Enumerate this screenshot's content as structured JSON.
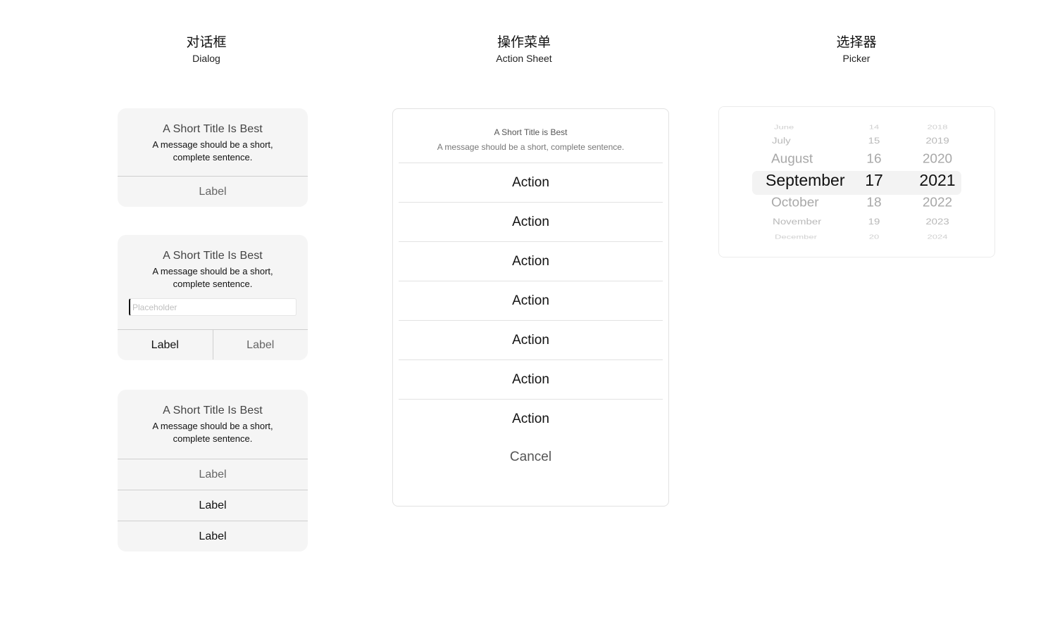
{
  "sections": {
    "dialog": {
      "zh": "对话框",
      "en": "Dialog"
    },
    "action_sheet": {
      "zh": "操作菜单",
      "en": "Action Sheet"
    },
    "picker": {
      "zh": "选择器",
      "en": "Picker"
    }
  },
  "dialogs": [
    {
      "title": "A Short Title Is Best",
      "message_line1": "A message should be a short,",
      "message_line2": "complete sentence.",
      "button": "Label"
    },
    {
      "title": "A Short Title Is Best",
      "message_line1": "A message should be a short,",
      "message_line2": "complete sentence.",
      "input_placeholder": "Placeholder",
      "input_value": "",
      "buttons": [
        "Label",
        "Label"
      ]
    },
    {
      "title": "A Short Title Is Best",
      "message_line1": "A message should be a short,",
      "message_line2": "complete sentence.",
      "buttons": [
        "Label",
        "Label",
        "Label"
      ]
    }
  ],
  "action_sheet": {
    "title": "A Short Title is Best",
    "message": "A message should be a short, complete sentence.",
    "actions": [
      "Action",
      "Action",
      "Action",
      "Action",
      "Action",
      "Action",
      "Action"
    ],
    "cancel": "Cancel"
  },
  "picker": {
    "months": [
      "June",
      "July",
      "August",
      "September",
      "October",
      "November",
      "December"
    ],
    "days": [
      "14",
      "15",
      "16",
      "17",
      "18",
      "19",
      "20"
    ],
    "years": [
      "2018",
      "2019",
      "2020",
      "2021",
      "2022",
      "2023",
      "2024"
    ],
    "selected": {
      "month": "September",
      "day": "17",
      "year": "2021"
    }
  },
  "colors": {
    "surface": "#f5f5f5",
    "divider": "#cfcfcf",
    "highlight": "#f3f3f3"
  }
}
